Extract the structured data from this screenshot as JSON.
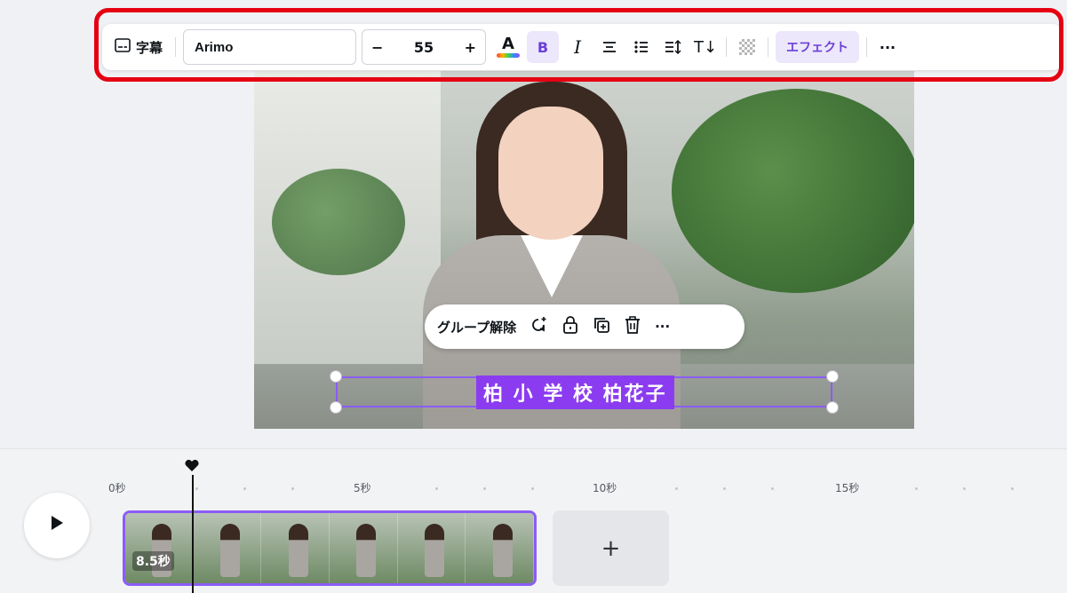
{
  "toolbar": {
    "captions_label": "字幕",
    "font_name": "Arimo",
    "font_size": "55",
    "minus": "−",
    "plus": "+",
    "bold": "B",
    "italic": "I",
    "effects_label": "エフェクト",
    "more": "···"
  },
  "context_menu": {
    "ungroup_label": "グループ解除",
    "more": "···"
  },
  "caption": {
    "text": "柏 小 学 校 柏花子"
  },
  "timeline": {
    "ticks": [
      "0秒",
      "5秒",
      "10秒",
      "15秒"
    ],
    "clip_duration": "8.5秒",
    "add_label": "+"
  },
  "colors": {
    "accent": "#8b5cf6",
    "highlight": "#e50012"
  }
}
